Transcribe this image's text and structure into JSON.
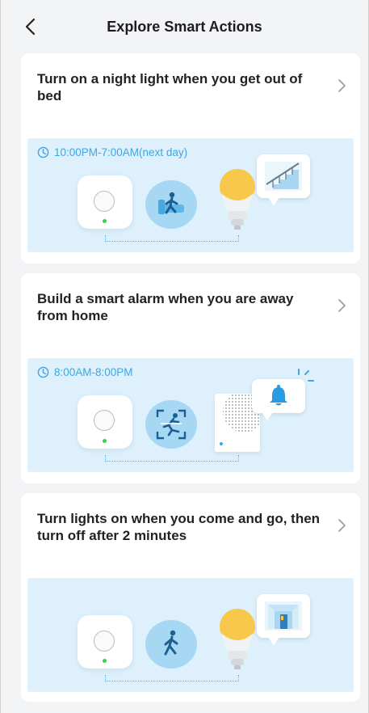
{
  "header": {
    "title": "Explore Smart Actions",
    "back_icon": "chevron-left-icon"
  },
  "cards": [
    {
      "title": "Turn on a night light when you get out of bed",
      "time": "10:00PM-7:00AM(next day)",
      "scene_icons": [
        "hub-icon",
        "motion-sensor-bed-icon",
        "light-bulb-icon",
        "stairs-icon"
      ]
    },
    {
      "title": "Build a smart alarm when you are away from home",
      "time": "8:00AM-8:00PM",
      "scene_icons": [
        "hub-icon",
        "motion-detection-icon",
        "speaker-siren-icon",
        "bell-icon"
      ]
    },
    {
      "title": "Turn lights on when you come and go, then turn off after 2 minutes",
      "time": "",
      "scene_icons": [
        "hub-icon",
        "walking-person-icon",
        "light-bulb-icon",
        "door-icon"
      ]
    }
  ],
  "colors": {
    "accent": "#3ba7e3",
    "illustration_bg": "#ddf0fb",
    "led_green": "#3ccf4e",
    "bulb_yellow": "#f8c84a"
  }
}
